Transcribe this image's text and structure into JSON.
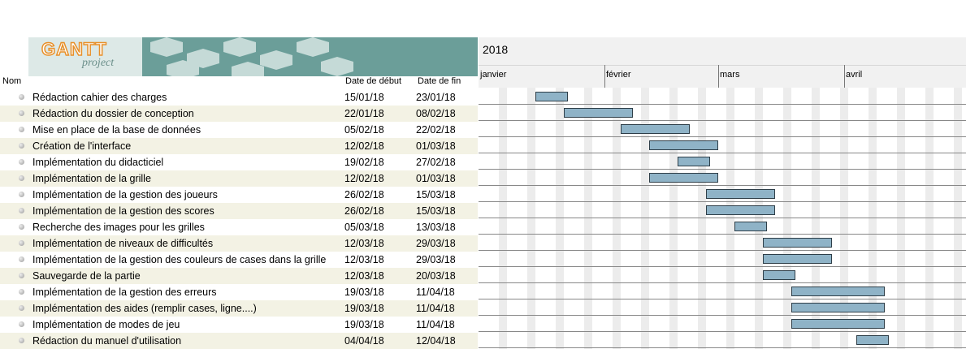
{
  "logo": {
    "brand": "GANTT",
    "sub": "project"
  },
  "columns": {
    "name": "Nom",
    "start": "Date de début",
    "end": "Date de fin"
  },
  "timeline": {
    "year": "2018",
    "months": [
      "janvier",
      "février",
      "mars",
      "avril"
    ]
  },
  "colors": {
    "bar": "#8fb3c7",
    "bar_border": "#2e3e48",
    "row_alt": "#f3f2e4",
    "logo_band": "#6b9e99"
  },
  "tasks": [
    {
      "name": "Rédaction cahier des charges",
      "start": "15/01/18",
      "end": "23/01/18"
    },
    {
      "name": "Rédaction du dossier de conception",
      "start": "22/01/18",
      "end": "08/02/18"
    },
    {
      "name": "Mise en place de la base de données",
      "start": "05/02/18",
      "end": "22/02/18"
    },
    {
      "name": "Création de l'interface",
      "start": "12/02/18",
      "end": "01/03/18"
    },
    {
      "name": "Implémentation du didacticiel",
      "start": "19/02/18",
      "end": "27/02/18"
    },
    {
      "name": "Implémentation de la grille",
      "start": "12/02/18",
      "end": "01/03/18"
    },
    {
      "name": "Implémentation de la gestion des joueurs",
      "start": "26/02/18",
      "end": "15/03/18"
    },
    {
      "name": "Implémentation de la gestion des scores",
      "start": "26/02/18",
      "end": "15/03/18"
    },
    {
      "name": "Recherche des images pour les grilles",
      "start": "05/03/18",
      "end": "13/03/18"
    },
    {
      "name": "Implémentation de niveaux de difficultés",
      "start": "12/03/18",
      "end": "29/03/18"
    },
    {
      "name": "Implémentation de la gestion des couleurs de cases dans la grille",
      "start": "12/03/18",
      "end": "29/03/18"
    },
    {
      "name": "Sauvegarde de la partie",
      "start": "12/03/18",
      "end": "20/03/18"
    },
    {
      "name": "Implémentation de la gestion des erreurs",
      "start": "19/03/18",
      "end": "11/04/18"
    },
    {
      "name": "Implémentation des aides (remplir cases, ligne....)",
      "start": "19/03/18",
      "end": "11/04/18"
    },
    {
      "name": "Implémentation de modes de jeu",
      "start": "19/03/18",
      "end": "11/04/18"
    },
    {
      "name": "Rédaction du manuel d'utilisation",
      "start": "04/04/18",
      "end": "12/04/18"
    }
  ]
}
